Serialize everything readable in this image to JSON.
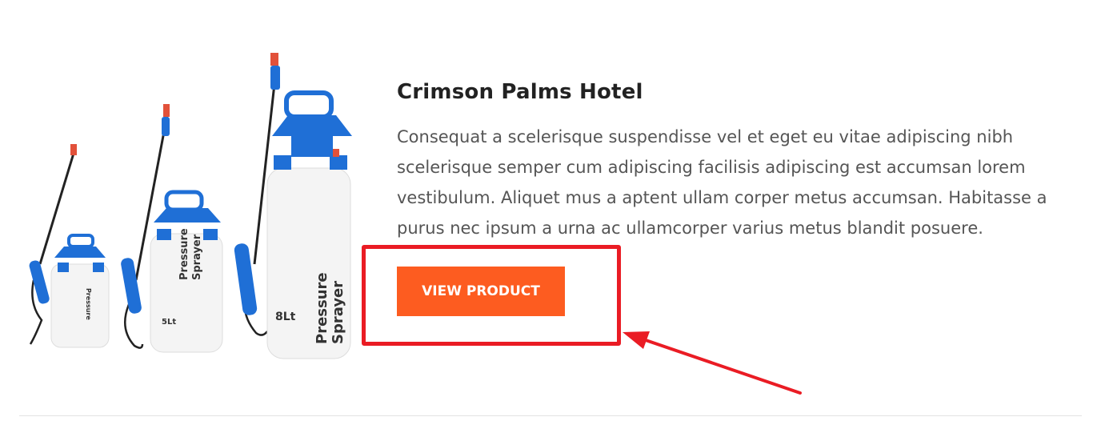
{
  "product": {
    "title": "Crimson Palms Hotel",
    "description": "Consequat a scelerisque suspendisse vel et eget eu vitae adipiscing nibh scelerisque semper cum adipiscing facilisis adipiscing est accumsan lorem vestibulum. Aliquet mus a aptent ullam corper metus accumsan. Habitasse a purus nec ipsum a urna ac ullamcorper varius metus blandit posuere.",
    "button_label": "VIEW PRODUCT",
    "image": {
      "subject": "pressure-sprayers",
      "labels": {
        "large_volume": "8Lt",
        "medium_volume": "5Lt",
        "brand_line1": "Pressure",
        "brand_line2": "Sprayer"
      }
    }
  },
  "colors": {
    "accent": "#fd5c20",
    "annotation": "#ea1c24",
    "title": "#222222",
    "text": "#555555",
    "divider": "#e2e2e2",
    "sprayer_blue": "#1f6fd6"
  }
}
